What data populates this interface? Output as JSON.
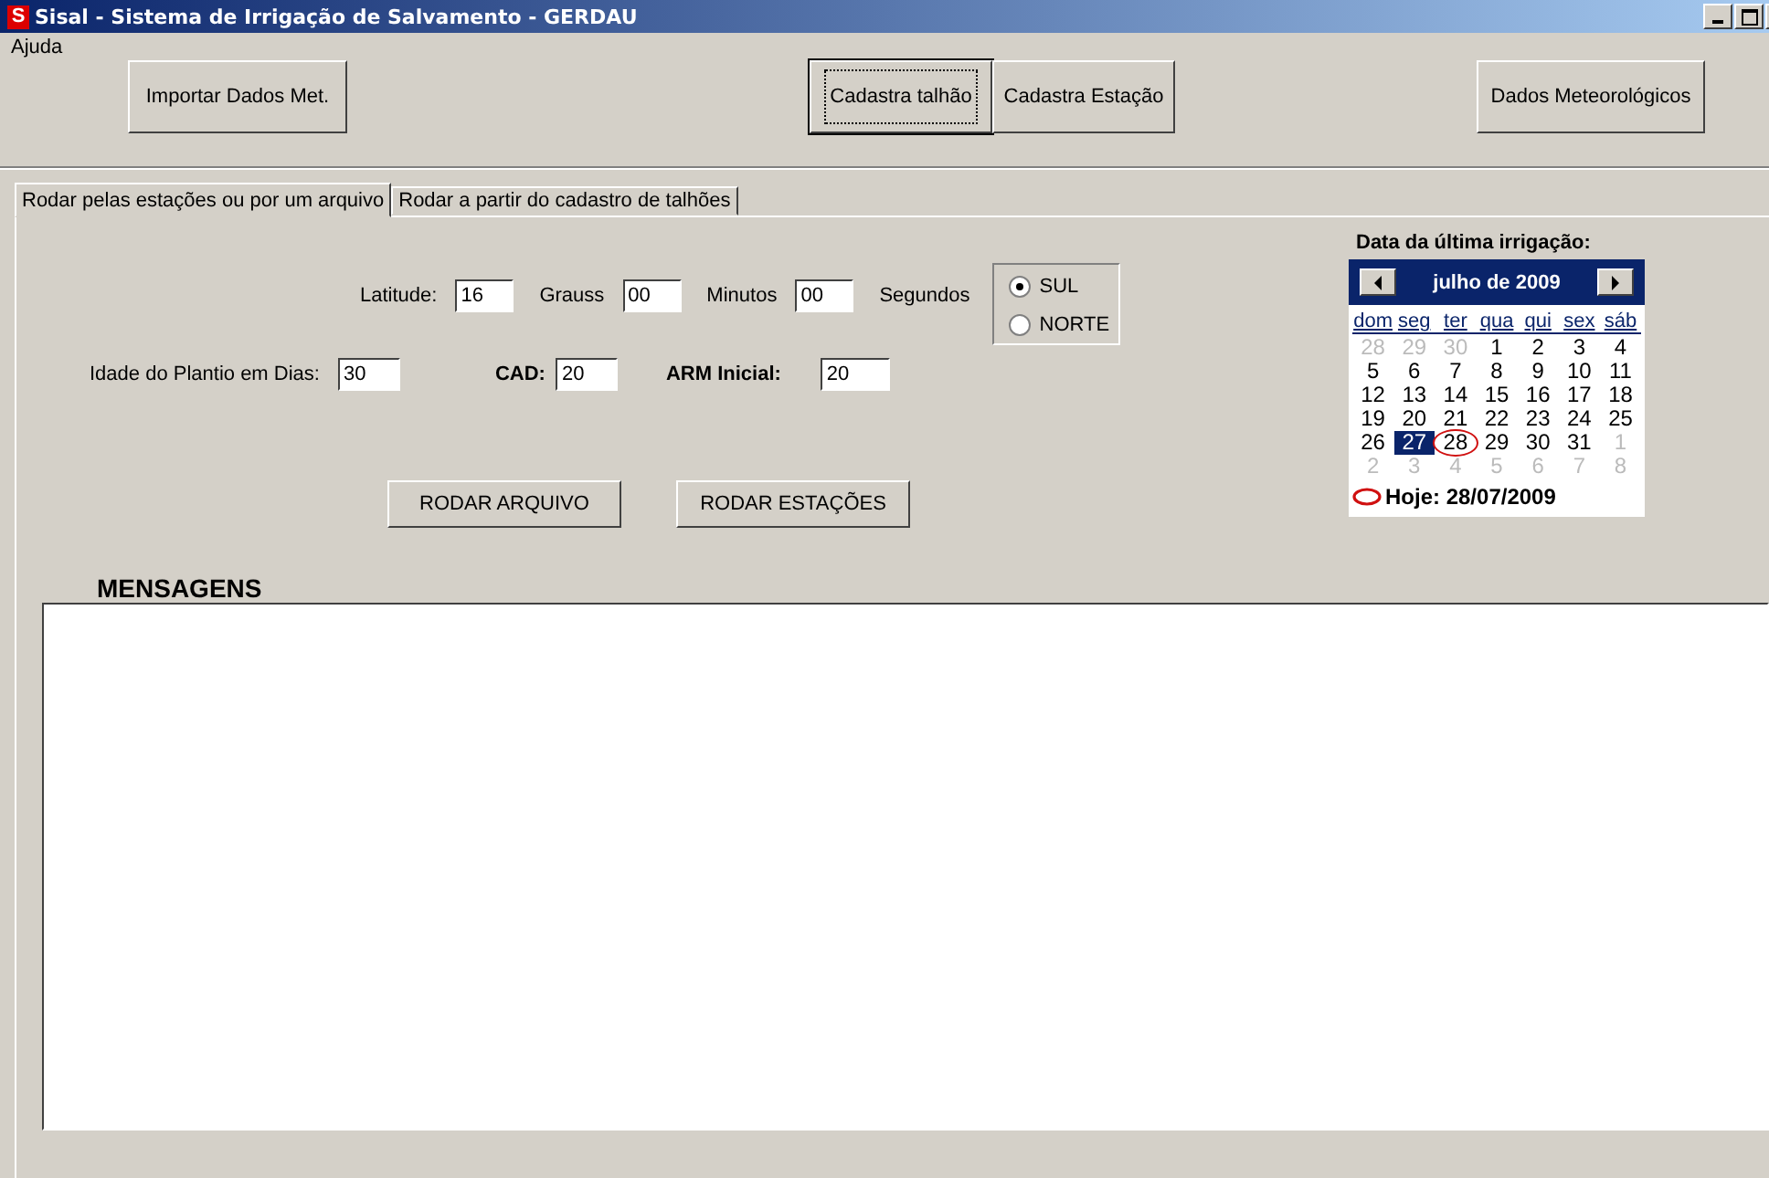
{
  "window": {
    "title": "Sisal - Sistema de Irrigação de Salvamento  - GERDAU",
    "app_icon": "S"
  },
  "menu": [
    "Ajuda"
  ],
  "toolbar": [
    {
      "label": "Importar Dados Met.",
      "focused": false
    },
    {
      "label": "Cadastra talhão",
      "focused": true
    },
    {
      "label": "Cadastra Estação",
      "focused": false
    },
    {
      "label": "Dados Meteorológicos",
      "focused": false
    }
  ],
  "tabs": [
    {
      "label": "Rodar pelas estações ou por um arquivo",
      "selected": true
    },
    {
      "label": "Rodar a partir do cadastro de talhões",
      "selected": false
    }
  ],
  "latitude": {
    "label": "Latitude:",
    "degrees": "16",
    "degrees_unit": "Grauss",
    "minutes": "00",
    "minutes_unit": "Minutos",
    "seconds": "00",
    "seconds_unit": "Segundos"
  },
  "hemisphere": [
    {
      "label": "SUL",
      "selected": true
    },
    {
      "label": "NORTE",
      "selected": false
    }
  ],
  "planting_age": {
    "label": "Idade do Plantio em Dias:",
    "value": "30"
  },
  "cad": {
    "label": "CAD:",
    "value": "20"
  },
  "arm": {
    "label": "ARM Inicial:",
    "value": "20"
  },
  "actions": [
    "RODAR ARQUIVO",
    "RODAR ESTAÇÕES"
  ],
  "messages": {
    "title": "MENSAGENS"
  },
  "calendar": {
    "title": "Data da  última irrigação:",
    "month": "julho de 2009",
    "weekdays": [
      "dom",
      "seg",
      "ter",
      "qua",
      "qui",
      "sex",
      "sáb"
    ],
    "weeks": [
      [
        {
          "day": "28",
          "muted": true,
          "selected": false,
          "today": false
        },
        {
          "day": "29",
          "muted": true,
          "selected": false,
          "today": false
        },
        {
          "day": "30",
          "muted": true,
          "selected": false,
          "today": false
        },
        {
          "day": "1",
          "muted": false,
          "selected": false,
          "today": false
        },
        {
          "day": "2",
          "muted": false,
          "selected": false,
          "today": false
        },
        {
          "day": "3",
          "muted": false,
          "selected": false,
          "today": false
        },
        {
          "day": "4",
          "muted": false,
          "selected": false,
          "today": false
        }
      ],
      [
        {
          "day": "5",
          "muted": false,
          "selected": false,
          "today": false
        },
        {
          "day": "6",
          "muted": false,
          "selected": false,
          "today": false
        },
        {
          "day": "7",
          "muted": false,
          "selected": false,
          "today": false
        },
        {
          "day": "8",
          "muted": false,
          "selected": false,
          "today": false
        },
        {
          "day": "9",
          "muted": false,
          "selected": false,
          "today": false
        },
        {
          "day": "10",
          "muted": false,
          "selected": false,
          "today": false
        },
        {
          "day": "11",
          "muted": false,
          "selected": false,
          "today": false
        }
      ],
      [
        {
          "day": "12",
          "muted": false,
          "selected": false,
          "today": false
        },
        {
          "day": "13",
          "muted": false,
          "selected": false,
          "today": false
        },
        {
          "day": "14",
          "muted": false,
          "selected": false,
          "today": false
        },
        {
          "day": "15",
          "muted": false,
          "selected": false,
          "today": false
        },
        {
          "day": "16",
          "muted": false,
          "selected": false,
          "today": false
        },
        {
          "day": "17",
          "muted": false,
          "selected": false,
          "today": false
        },
        {
          "day": "18",
          "muted": false,
          "selected": false,
          "today": false
        }
      ],
      [
        {
          "day": "19",
          "muted": false,
          "selected": false,
          "today": false
        },
        {
          "day": "20",
          "muted": false,
          "selected": false,
          "today": false
        },
        {
          "day": "21",
          "muted": false,
          "selected": false,
          "today": false
        },
        {
          "day": "22",
          "muted": false,
          "selected": false,
          "today": false
        },
        {
          "day": "23",
          "muted": false,
          "selected": false,
          "today": false
        },
        {
          "day": "24",
          "muted": false,
          "selected": false,
          "today": false
        },
        {
          "day": "25",
          "muted": false,
          "selected": false,
          "today": false
        }
      ],
      [
        {
          "day": "26",
          "muted": false,
          "selected": false,
          "today": false
        },
        {
          "day": "27",
          "muted": false,
          "selected": true,
          "today": false
        },
        {
          "day": "28",
          "muted": false,
          "selected": false,
          "today": true
        },
        {
          "day": "29",
          "muted": false,
          "selected": false,
          "today": false
        },
        {
          "day": "30",
          "muted": false,
          "selected": false,
          "today": false
        },
        {
          "day": "31",
          "muted": false,
          "selected": false,
          "today": false
        },
        {
          "day": "1",
          "muted": true,
          "selected": false,
          "today": false
        }
      ],
      [
        {
          "day": "2",
          "muted": true,
          "selected": false,
          "today": false
        },
        {
          "day": "3",
          "muted": true,
          "selected": false,
          "today": false
        },
        {
          "day": "4",
          "muted": true,
          "selected": false,
          "today": false
        },
        {
          "day": "5",
          "muted": true,
          "selected": false,
          "today": false
        },
        {
          "day": "6",
          "muted": true,
          "selected": false,
          "today": false
        },
        {
          "day": "7",
          "muted": true,
          "selected": false,
          "today": false
        },
        {
          "day": "8",
          "muted": true,
          "selected": false,
          "today": false
        }
      ]
    ],
    "today_label": "Hoje: 28/07/2009"
  }
}
